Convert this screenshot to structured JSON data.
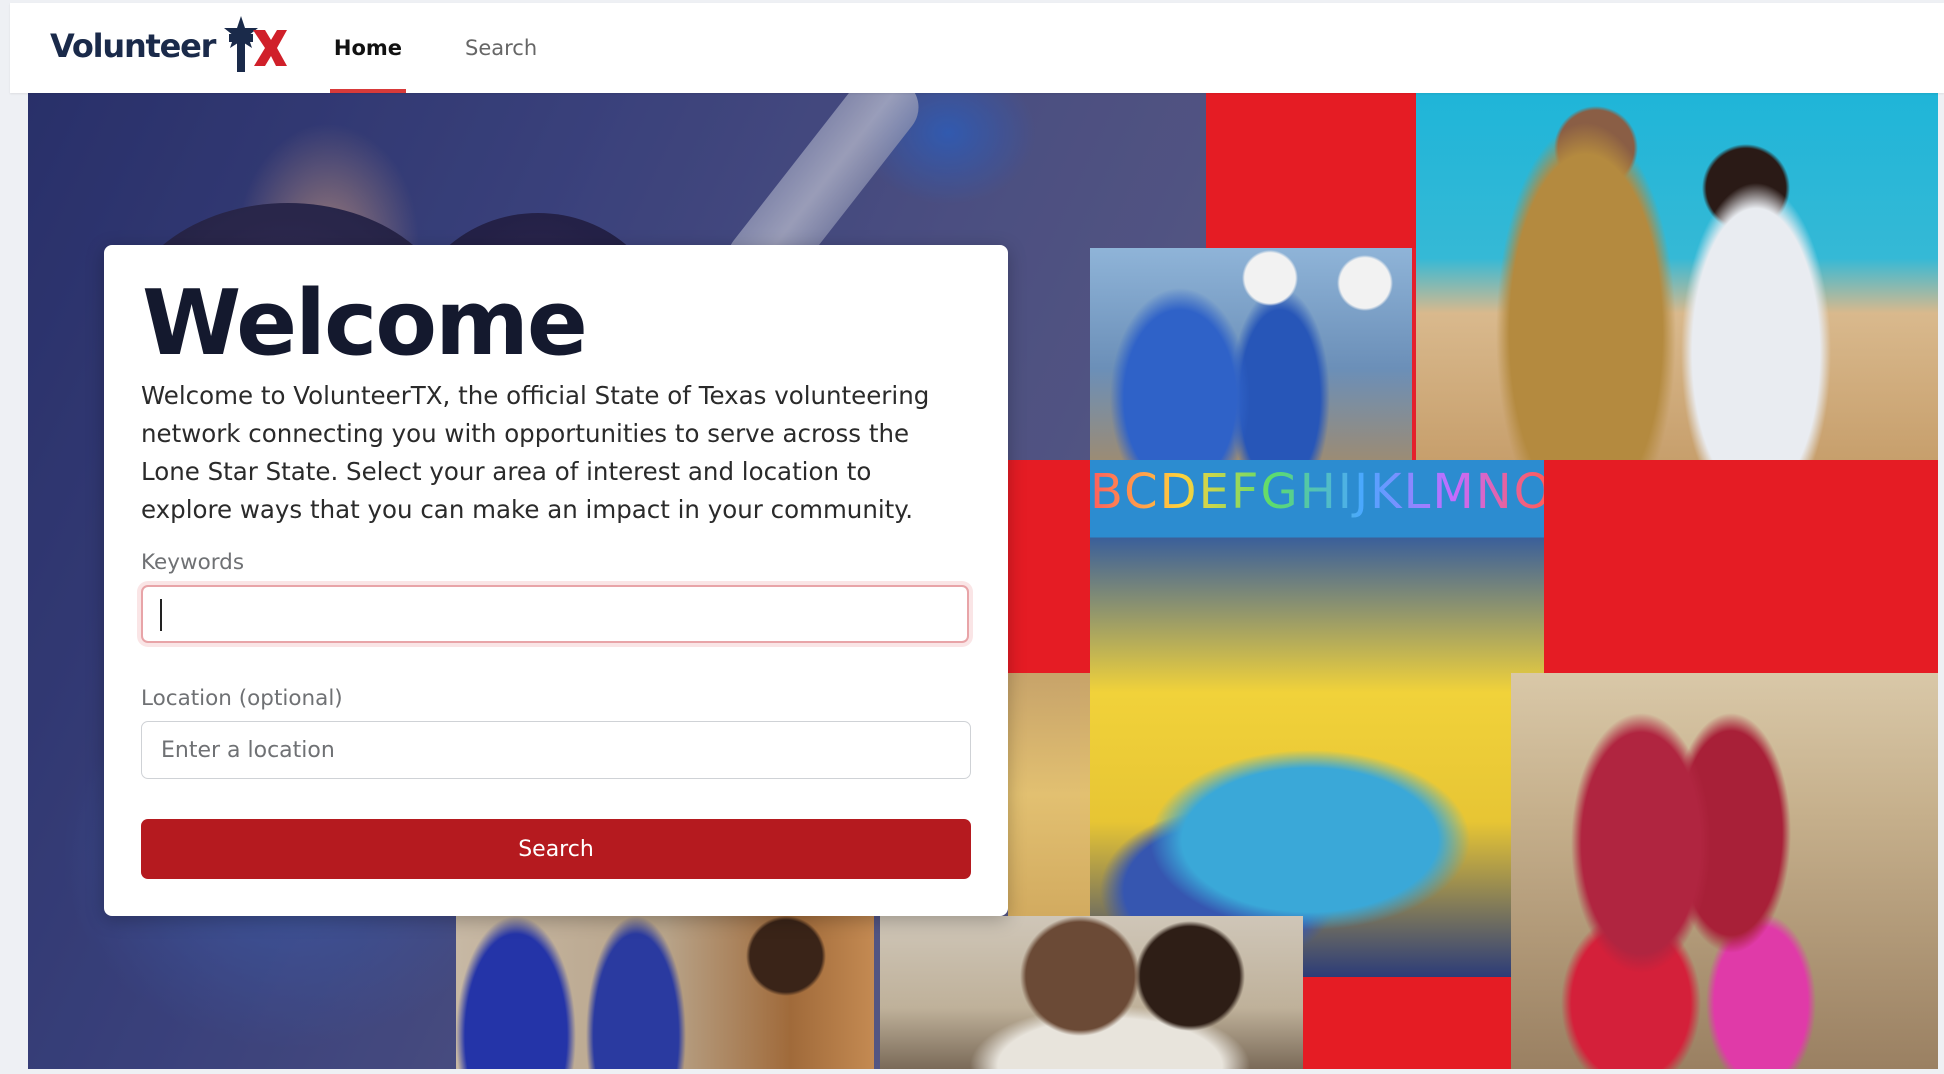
{
  "header": {
    "logo_text": "Volunteer",
    "logo_mark": "TX",
    "nav": [
      {
        "label": "Home",
        "active": true
      },
      {
        "label": "Search",
        "active": false
      }
    ]
  },
  "card": {
    "title": "Welcome",
    "intro": "Welcome to VolunteerTX, the official State of Texas volunteering network connecting you with opportunities to serve across the Lone Star State. Select your area of interest and location to explore ways that you can make an impact in your community.",
    "keywords_label": "Keywords",
    "keywords_value": "",
    "location_label": "Location (optional)",
    "location_placeholder": "Enter a location",
    "search_button": "Search"
  },
  "hero": {
    "classroom_banner": "BCDEFGHIJKLMNOP"
  },
  "colors": {
    "brand_red": "#b51a1f",
    "collage_red": "#e51c24",
    "navy": "#1a2a4a"
  },
  "icons": [
    "texas-star-logo-icon"
  ]
}
